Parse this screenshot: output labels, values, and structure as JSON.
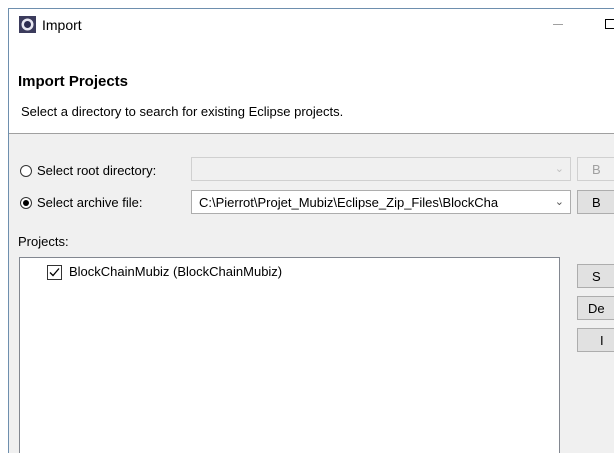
{
  "window": {
    "title": "Import"
  },
  "header": {
    "title": "Import Projects",
    "description": "Select a directory to search for existing Eclipse projects."
  },
  "options": {
    "root_directory": {
      "label": "Select root directory:",
      "selected": false,
      "value": ""
    },
    "archive_file": {
      "label": "Select archive file:",
      "selected": true,
      "value": "C:\\Pierrot\\Projet_Mubiz\\Eclipse_Zip_Files\\BlockCha"
    }
  },
  "side_buttons": {
    "browse_root": "B",
    "browse_archive": "B",
    "select_all": "S",
    "deselect_all": "De",
    "refresh": "I"
  },
  "projects": {
    "label": "Projects:",
    "items": [
      {
        "label": "BlockChainMubiz (BlockChainMubiz)",
        "checked": true
      }
    ]
  },
  "icons": {
    "app": "eclipse-icon",
    "dropdown": "chevron-down-icon",
    "check": "checkmark-icon"
  }
}
